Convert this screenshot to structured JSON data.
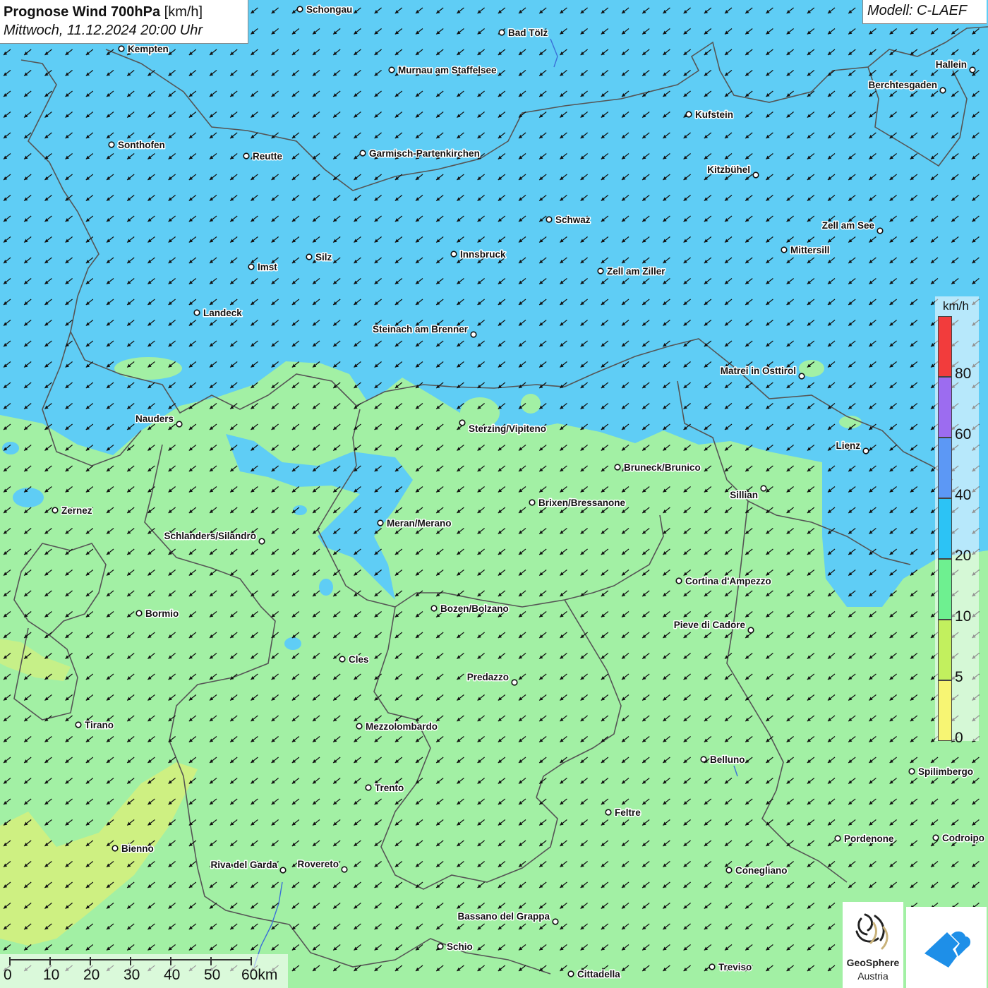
{
  "header": {
    "title_bold": "Prognose Wind 700hPa",
    "title_unit": " [km/h]",
    "datetime": "Mittwoch, 11.12.2024 20:00 Uhr",
    "model": "Modell: C-LAEF"
  },
  "legend": {
    "unit": "km/h",
    "classes": [
      {
        "label": "80",
        "color": "#f23c3c"
      },
      {
        "label": "60",
        "color": "#9c6cf0"
      },
      {
        "label": "40",
        "color": "#5c98f5"
      },
      {
        "label": "20",
        "color": "#2cc3f5"
      },
      {
        "label": "10",
        "color": "#6ef090"
      },
      {
        "label": "5",
        "color": "#c2f05e"
      },
      {
        "label": "0",
        "color": "#f7f573"
      }
    ]
  },
  "colors": {
    "wind_20_40": "#5fcdf5",
    "wind_10_20": "#a2f0a4",
    "wind_5_10": "#d6f07c",
    "border": "#555555",
    "arrow": "#111111"
  },
  "scalebar": {
    "labels": [
      "0",
      "10",
      "20",
      "30",
      "40",
      "50",
      "60km"
    ]
  },
  "logos": {
    "geosphere_name": "GeoSphere",
    "geosphere_sub": "Austria",
    "warn_icon": "cloud-warning-icon"
  },
  "cities": [
    "Schongau",
    "Bad Tölz",
    "Kempten",
    "Murnau am Staffelsee",
    "Hallein",
    "Berchtesgaden",
    "Kufstein",
    "Sonthofen",
    "Reutte",
    "Garmisch-Partenkirchen",
    "Kitzbühel",
    "Schwaz",
    "Zell am See",
    "Mittersill",
    "Innsbruck",
    "Silz",
    "Imst",
    "Zell am Ziller",
    "Landeck",
    "Steinach am Brenner",
    "Matrei in Osttirol",
    "Nauders",
    "Sterzing/Vipiteno",
    "Lienz",
    "Bruneck/Brunico",
    "Sillian",
    "Brixen/Bressanone",
    "Zernez",
    "Meran/Merano",
    "Schlanders/Silandro",
    "Cortina d'Ampezzo",
    "Bozen/Bolzano",
    "Bormio",
    "Pieve di Cadore",
    "Cles",
    "Predazzo",
    "Tirano",
    "Mezzolombardo",
    "Belluno",
    "Spilimbergo",
    "Trento",
    "Feltre",
    "Pordenone",
    "Codroipo",
    "Bienno",
    "Riva del Garda",
    "Rovereto",
    "Conegliano",
    "Bassano del Grappa",
    "Schio",
    "Treviso",
    "Cittadella"
  ]
}
